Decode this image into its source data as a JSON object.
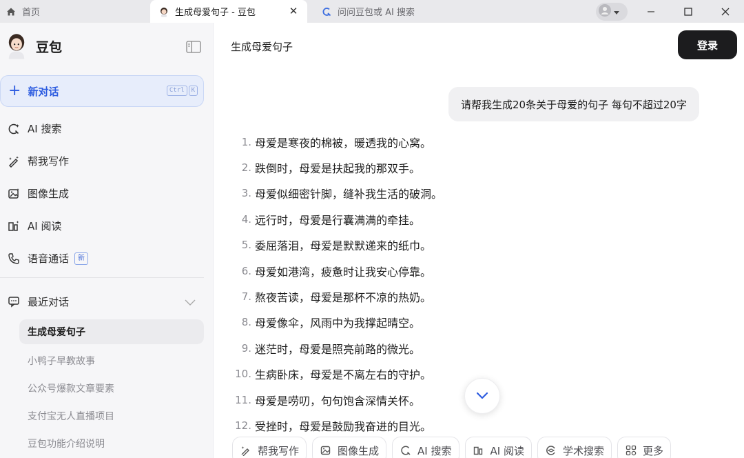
{
  "tabs": {
    "home": "首页",
    "active": "生成母爱句子 - 豆包",
    "search": "问问豆包或 AI 搜索"
  },
  "sidebar": {
    "brand": "豆包",
    "new_chat": "新对话",
    "shortcut": [
      "Ctrl",
      "K"
    ],
    "nav": [
      {
        "label": "AI 搜索",
        "icon": "ai-search-icon"
      },
      {
        "label": "帮我写作",
        "icon": "write-icon"
      },
      {
        "label": "图像生成",
        "icon": "image-icon"
      },
      {
        "label": "AI 阅读",
        "icon": "read-icon"
      },
      {
        "label": "语音通话",
        "icon": "phone-icon",
        "badge": "新"
      }
    ],
    "recent_label": "最近对话",
    "history": [
      "生成母爱句子",
      "小鸭子早教故事",
      "公众号爆款文章要素",
      "支付宝无人直播项目",
      "豆包功能介绍说明"
    ]
  },
  "main": {
    "title": "生成母爱句子",
    "login": "登录",
    "user_message": "请帮我生成20条关于母爱的句子 每句不超过20字",
    "answers": [
      {
        "n": "1.",
        "text": "母爱是寒夜的棉被，暖透我的心窝。"
      },
      {
        "n": "2.",
        "text": "跌倒时，母爱是扶起我的那双手。"
      },
      {
        "n": "3.",
        "text": "母爱似细密针脚，缝补我生活的破洞。"
      },
      {
        "n": "4.",
        "text": "远行时，母爱是行囊满满的牵挂。"
      },
      {
        "n": "5.",
        "text": "委屈落泪，母爱是默默递来的纸巾。"
      },
      {
        "n": "6.",
        "text": "母爱如港湾，疲惫时让我安心停靠。"
      },
      {
        "n": "7.",
        "text": "熬夜苦读，母爱是那杯不凉的热奶。"
      },
      {
        "n": "8.",
        "text": "母爱像伞，风雨中为我撑起晴空。"
      },
      {
        "n": "9.",
        "text": "迷茫时，母爱是照亮前路的微光。"
      },
      {
        "n": "10.",
        "text": "生病卧床，母爱是不离左右的守护。"
      },
      {
        "n": "11.",
        "text": "母爱是唠叨，句句饱含深情关怀。"
      },
      {
        "n": "12.",
        "text": "受挫时，母爱是鼓励我奋进的目光。"
      }
    ],
    "tools": [
      {
        "label": "帮我写作",
        "icon": "write-icon"
      },
      {
        "label": "图像生成",
        "icon": "image-icon"
      },
      {
        "label": "AI 搜索",
        "icon": "ai-search-icon"
      },
      {
        "label": "AI 阅读",
        "icon": "read-icon"
      },
      {
        "label": "学术搜索",
        "icon": "academic-icon"
      },
      {
        "label": "更多",
        "icon": "more-icon"
      }
    ]
  },
  "colors": {
    "accent": "#2d5ce0",
    "login_bg": "#1c1c1e",
    "sidebar_bg": "#f6f6f8"
  }
}
